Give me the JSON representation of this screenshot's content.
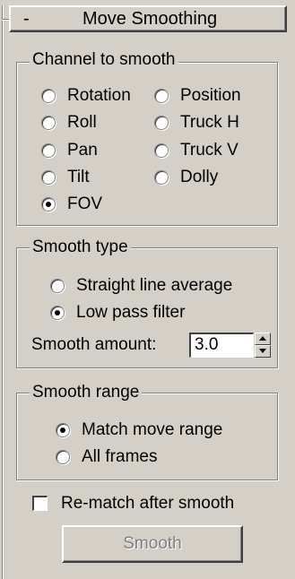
{
  "rollout": {
    "toggle": "-",
    "title": "Move Smoothing"
  },
  "channel": {
    "title": "Channel to smooth",
    "options": [
      {
        "label": "Rotation",
        "selected": false
      },
      {
        "label": "Position",
        "selected": false
      },
      {
        "label": "Roll",
        "selected": false
      },
      {
        "label": "Truck H",
        "selected": false
      },
      {
        "label": "Pan",
        "selected": false
      },
      {
        "label": "Truck V",
        "selected": false
      },
      {
        "label": "Tilt",
        "selected": false
      },
      {
        "label": "Dolly",
        "selected": false
      },
      {
        "label": "FOV",
        "selected": true
      }
    ]
  },
  "smooth_type": {
    "title": "Smooth type",
    "options": [
      {
        "label": "Straight line average",
        "selected": false
      },
      {
        "label": "Low pass filter",
        "selected": true
      }
    ],
    "amount_label": "Smooth amount:",
    "amount_value": "3.0"
  },
  "smooth_range": {
    "title": "Smooth range",
    "options": [
      {
        "label": "Match move range",
        "selected": true
      },
      {
        "label": "All frames",
        "selected": false
      }
    ]
  },
  "rematch": {
    "label": "Re-match after smooth",
    "checked": false
  },
  "smooth_button": {
    "label": "Smooth",
    "enabled": false
  }
}
